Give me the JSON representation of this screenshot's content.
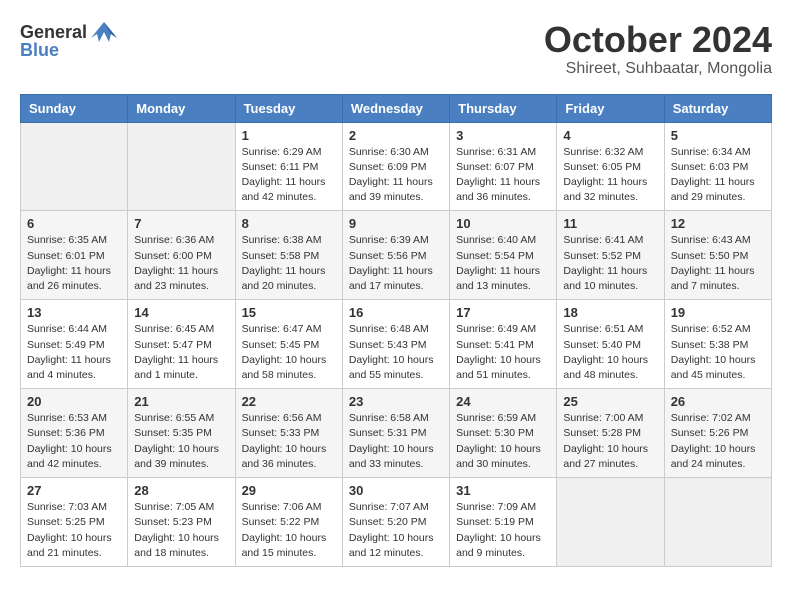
{
  "logo": {
    "general": "General",
    "blue": "Blue"
  },
  "header": {
    "month": "October 2024",
    "location": "Shireet, Suhbaatar, Mongolia"
  },
  "weekdays": [
    "Sunday",
    "Monday",
    "Tuesday",
    "Wednesday",
    "Thursday",
    "Friday",
    "Saturday"
  ],
  "weeks": [
    [
      {
        "day": "",
        "info": ""
      },
      {
        "day": "",
        "info": ""
      },
      {
        "day": "1",
        "info": "Sunrise: 6:29 AM\nSunset: 6:11 PM\nDaylight: 11 hours\nand 42 minutes."
      },
      {
        "day": "2",
        "info": "Sunrise: 6:30 AM\nSunset: 6:09 PM\nDaylight: 11 hours\nand 39 minutes."
      },
      {
        "day": "3",
        "info": "Sunrise: 6:31 AM\nSunset: 6:07 PM\nDaylight: 11 hours\nand 36 minutes."
      },
      {
        "day": "4",
        "info": "Sunrise: 6:32 AM\nSunset: 6:05 PM\nDaylight: 11 hours\nand 32 minutes."
      },
      {
        "day": "5",
        "info": "Sunrise: 6:34 AM\nSunset: 6:03 PM\nDaylight: 11 hours\nand 29 minutes."
      }
    ],
    [
      {
        "day": "6",
        "info": "Sunrise: 6:35 AM\nSunset: 6:01 PM\nDaylight: 11 hours\nand 26 minutes."
      },
      {
        "day": "7",
        "info": "Sunrise: 6:36 AM\nSunset: 6:00 PM\nDaylight: 11 hours\nand 23 minutes."
      },
      {
        "day": "8",
        "info": "Sunrise: 6:38 AM\nSunset: 5:58 PM\nDaylight: 11 hours\nand 20 minutes."
      },
      {
        "day": "9",
        "info": "Sunrise: 6:39 AM\nSunset: 5:56 PM\nDaylight: 11 hours\nand 17 minutes."
      },
      {
        "day": "10",
        "info": "Sunrise: 6:40 AM\nSunset: 5:54 PM\nDaylight: 11 hours\nand 13 minutes."
      },
      {
        "day": "11",
        "info": "Sunrise: 6:41 AM\nSunset: 5:52 PM\nDaylight: 11 hours\nand 10 minutes."
      },
      {
        "day": "12",
        "info": "Sunrise: 6:43 AM\nSunset: 5:50 PM\nDaylight: 11 hours\nand 7 minutes."
      }
    ],
    [
      {
        "day": "13",
        "info": "Sunrise: 6:44 AM\nSunset: 5:49 PM\nDaylight: 11 hours\nand 4 minutes."
      },
      {
        "day": "14",
        "info": "Sunrise: 6:45 AM\nSunset: 5:47 PM\nDaylight: 11 hours\nand 1 minute."
      },
      {
        "day": "15",
        "info": "Sunrise: 6:47 AM\nSunset: 5:45 PM\nDaylight: 10 hours\nand 58 minutes."
      },
      {
        "day": "16",
        "info": "Sunrise: 6:48 AM\nSunset: 5:43 PM\nDaylight: 10 hours\nand 55 minutes."
      },
      {
        "day": "17",
        "info": "Sunrise: 6:49 AM\nSunset: 5:41 PM\nDaylight: 10 hours\nand 51 minutes."
      },
      {
        "day": "18",
        "info": "Sunrise: 6:51 AM\nSunset: 5:40 PM\nDaylight: 10 hours\nand 48 minutes."
      },
      {
        "day": "19",
        "info": "Sunrise: 6:52 AM\nSunset: 5:38 PM\nDaylight: 10 hours\nand 45 minutes."
      }
    ],
    [
      {
        "day": "20",
        "info": "Sunrise: 6:53 AM\nSunset: 5:36 PM\nDaylight: 10 hours\nand 42 minutes."
      },
      {
        "day": "21",
        "info": "Sunrise: 6:55 AM\nSunset: 5:35 PM\nDaylight: 10 hours\nand 39 minutes."
      },
      {
        "day": "22",
        "info": "Sunrise: 6:56 AM\nSunset: 5:33 PM\nDaylight: 10 hours\nand 36 minutes."
      },
      {
        "day": "23",
        "info": "Sunrise: 6:58 AM\nSunset: 5:31 PM\nDaylight: 10 hours\nand 33 minutes."
      },
      {
        "day": "24",
        "info": "Sunrise: 6:59 AM\nSunset: 5:30 PM\nDaylight: 10 hours\nand 30 minutes."
      },
      {
        "day": "25",
        "info": "Sunrise: 7:00 AM\nSunset: 5:28 PM\nDaylight: 10 hours\nand 27 minutes."
      },
      {
        "day": "26",
        "info": "Sunrise: 7:02 AM\nSunset: 5:26 PM\nDaylight: 10 hours\nand 24 minutes."
      }
    ],
    [
      {
        "day": "27",
        "info": "Sunrise: 7:03 AM\nSunset: 5:25 PM\nDaylight: 10 hours\nand 21 minutes."
      },
      {
        "day": "28",
        "info": "Sunrise: 7:05 AM\nSunset: 5:23 PM\nDaylight: 10 hours\nand 18 minutes."
      },
      {
        "day": "29",
        "info": "Sunrise: 7:06 AM\nSunset: 5:22 PM\nDaylight: 10 hours\nand 15 minutes."
      },
      {
        "day": "30",
        "info": "Sunrise: 7:07 AM\nSunset: 5:20 PM\nDaylight: 10 hours\nand 12 minutes."
      },
      {
        "day": "31",
        "info": "Sunrise: 7:09 AM\nSunset: 5:19 PM\nDaylight: 10 hours\nand 9 minutes."
      },
      {
        "day": "",
        "info": ""
      },
      {
        "day": "",
        "info": ""
      }
    ]
  ]
}
